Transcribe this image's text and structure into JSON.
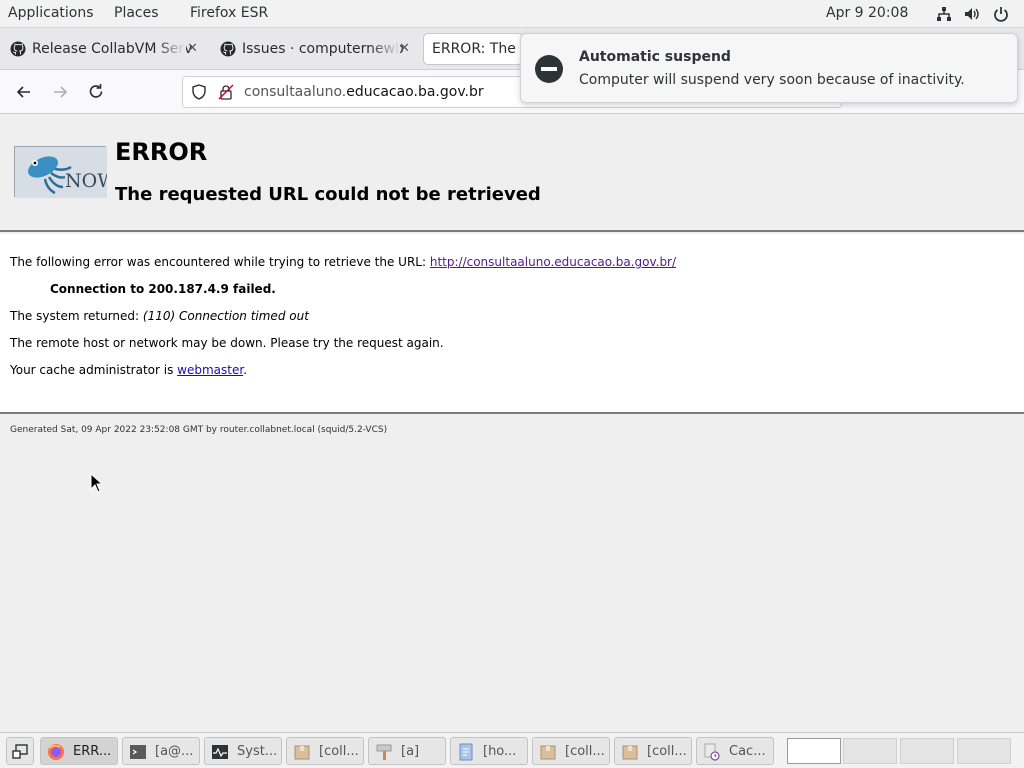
{
  "topbar": {
    "applications": "Applications",
    "places": "Places",
    "active_app": "Firefox ESR",
    "clock": "Apr 9  20:08",
    "tray_icons": [
      "network-icon",
      "volume-icon",
      "power-icon"
    ]
  },
  "tabs": [
    {
      "title": "Release CollabVM Serv",
      "icon": "github-icon"
    },
    {
      "title": "Issues · computernewb",
      "icon": "github-icon"
    },
    {
      "title": "ERROR: The r",
      "icon": "none"
    }
  ],
  "urlbar": {
    "url_prefix": "consultaaluno.",
    "url_domain": "educacao.ba.gov.br"
  },
  "notification": {
    "title": "Automatic suspend",
    "body": "Computer will suspend very soon because of inactivity."
  },
  "page": {
    "logo_text": "NOW",
    "title": "ERROR",
    "subtitle": "The requested URL could not be retrieved",
    "line1_text": "The following error was encountered while trying to retrieve the URL:",
    "line1_link": "http://consultaaluno.educacao.ba.gov.br/",
    "connection": "Connection to 200.187.4.9 failed.",
    "returned_prefix": "The system returned:",
    "returned_value": "(110) Connection timed out",
    "remote_msg": "The remote host or network may be down. Please try the request again.",
    "cache_prefix": "Your cache administrator is",
    "cache_link": "webmaster",
    "cache_suffix": ".",
    "footer": "Generated Sat, 09 Apr 2022 23:52:08 GMT by router.collabnet.local (squid/5.2-VCS)"
  },
  "taskbar": {
    "items": [
      {
        "label": "ERR...",
        "icon": "firefox-icon"
      },
      {
        "label": "[a@...",
        "icon": "terminal-icon"
      },
      {
        "label": "Syst...",
        "icon": "system-monitor-icon"
      },
      {
        "label": "[coll...",
        "icon": "package-icon"
      },
      {
        "label": "[a]",
        "icon": "paint-icon"
      },
      {
        "label": "[ho...",
        "icon": "document-icon"
      },
      {
        "label": "[coll...",
        "icon": "package-icon"
      },
      {
        "label": "[coll...",
        "icon": "package-icon"
      },
      {
        "label": "Cac...",
        "icon": "cache-icon"
      }
    ]
  },
  "colors": {
    "link": "#1a0dab",
    "visited_link": "#551a8b",
    "page_bg": "#efefef"
  }
}
